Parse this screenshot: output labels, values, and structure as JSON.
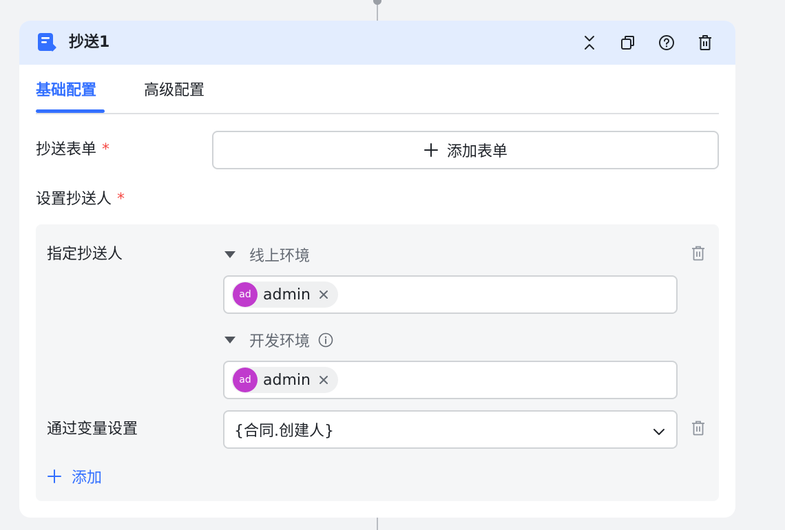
{
  "node": {
    "title": "抄送1",
    "icon": "cc-send-icon",
    "accent": "#3370ff",
    "header_bg": "#e3edfe",
    "actions": [
      "collapse-icon",
      "copy-icon",
      "help-icon",
      "delete-icon"
    ]
  },
  "tabs": [
    {
      "label": "基础配置",
      "active": true
    },
    {
      "label": "高级配置",
      "active": false
    }
  ],
  "form": {
    "cc_form_label": "抄送表单",
    "required_mark": "*",
    "add_form_button": "添加表单",
    "set_cc_label": "设置抄送人"
  },
  "panel": {
    "designate_label": "指定抄送人",
    "environments": [
      {
        "name": "线上环境",
        "users": [
          {
            "avatar": "ad",
            "name": "admin",
            "avatar_color": "#c03bcd"
          }
        ]
      },
      {
        "name": "开发环境",
        "users": [
          {
            "avatar": "ad",
            "name": "admin",
            "avatar_color": "#c03bcd"
          }
        ]
      }
    ],
    "variable_label": "通过变量设置",
    "variable_value": "{合同.创建人}",
    "add_label": "添加"
  }
}
